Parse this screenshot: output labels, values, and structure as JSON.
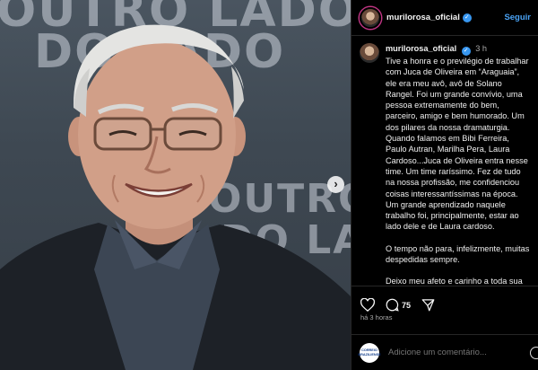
{
  "photo": {
    "backdrop_line1": "OUTRO LADO",
    "backdrop_line2": "DO LADO",
    "backdrop_line3": "OUTRO O",
    "backdrop_line4": "DO LADO",
    "next_icon": "chevron-right-icon"
  },
  "header": {
    "username": "murilorosa_oficial",
    "verified_icon": "verified-badge-icon",
    "follow_label": "Seguir",
    "accent": "#4aa3f5"
  },
  "caption": {
    "username": "murilorosa_oficial",
    "time": "3 h",
    "paragraphs": [
      "Tive a honra e o previlégio de trabalhar com Juca de Oliveira em “Araguaia”, ele era meu avô, avô de Solano Rangel. Foi um grande convívio, uma pessoa extremamente do bem, parceiro, amigo e bem humorado. Um dos pilares da nossa dramaturgia. Quando falamos em Bibi Ferreira, Paulo Autran, Marilha Pera, Laura Cardoso...Juca de Oliveira entra nesse time. Um time raríssimo. Fez de tudo na nossa profissão, me confidenciou coisas interessantíssimas na época. Um grande aprendizado naquele trabalho foi, principalmente, estar ao lado dele e de Laura cardoso.",
      "O tempo não para, infelizmente, muitas despedidas sempre.",
      "Deixo meu afeto e carinho a toda sua família."
    ]
  },
  "actions": {
    "like_icon": "heart-icon",
    "comment_icon": "comment-icon",
    "comment_count": "75",
    "share_icon": "send-icon",
    "posted_ago": "há 3 horas"
  },
  "comment_box": {
    "brand_logo_text": "CORREIO BRAZILIENSE",
    "placeholder": "Adicione um comentário...",
    "emoji_icon": "emoji-icon"
  }
}
